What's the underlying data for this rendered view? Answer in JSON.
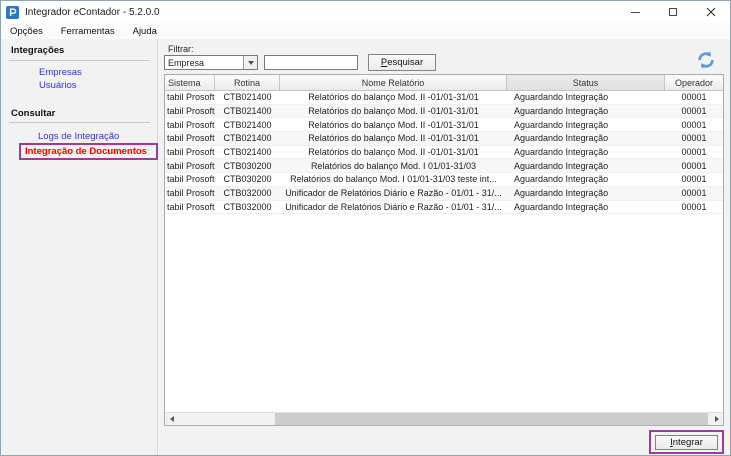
{
  "window": {
    "title": "Integrador eContador - 5.2.0.0"
  },
  "menu": {
    "items": [
      {
        "label": "Opções"
      },
      {
        "label": "Ferramentas"
      },
      {
        "label": "Ajuda"
      }
    ]
  },
  "sidebar": {
    "section1": {
      "header": "Integrações",
      "link1": "Empresas",
      "link2": "Usuários"
    },
    "section2": {
      "header": "Consultar",
      "link1": "Logs de Integração",
      "link2": "Integração de Documentos"
    }
  },
  "filter": {
    "label": "Filtrar:",
    "type_value": "Empresa",
    "search_value": "",
    "search_button": "Pesquisar"
  },
  "table": {
    "columns": [
      "Sistema",
      "Rotina",
      "Nome Relatório",
      "Status",
      "Operador"
    ],
    "rows": [
      [
        "tabil Prosoft",
        "CTB021400",
        "Relatórios do balanço Mod. II -01/01-31/01",
        "Aguardando Integração",
        "00001"
      ],
      [
        "tabil Prosoft",
        "CTB021400",
        "Relatórios do balanço Mod. II -01/01-31/01",
        "Aguardando Integração",
        "00001"
      ],
      [
        "tabil Prosoft",
        "CTB021400",
        "Relatórios do balanço Mod. II -01/01-31/01",
        "Aguardando Integração",
        "00001"
      ],
      [
        "tabil Prosoft",
        "CTB021400",
        "Relatórios do balanço Mod. II -01/01-31/01",
        "Aguardando Integração",
        "00001"
      ],
      [
        "tabil Prosoft",
        "CTB021400",
        "Relatórios do balanço Mod. II -01/01-31/01",
        "Aguardando Integração",
        "00001"
      ],
      [
        "tabil Prosoft",
        "CTB030200",
        "Relatórios do balanço Mod. I 01/01-31/03",
        "Aguardando Integração",
        "00001"
      ],
      [
        "tabil Prosoft",
        "CTB030200",
        "Relatórios do balanço Mod. I 01/01-31/03 teste int...",
        "Aguardando Integração",
        "00001"
      ],
      [
        "tabil Prosoft",
        "CTB032000",
        "Unificador de Relatórios Diário e Razão - 01/01 - 31/...",
        "Aguardando Integração",
        "00001"
      ],
      [
        "tabil Prosoft",
        "CTB032000",
        "Unificador de Relatórios Diário e Razão - 01/01 - 31/...",
        "Aguardando Integração",
        "00001"
      ]
    ]
  },
  "footer": {
    "integrate_button": "Integrar"
  },
  "colors": {
    "link_blue": "#3434d6",
    "active_link_red": "#ff0000",
    "annotation_purple": "#9c3a9e",
    "refresh_blue": "#5b9bd5"
  }
}
